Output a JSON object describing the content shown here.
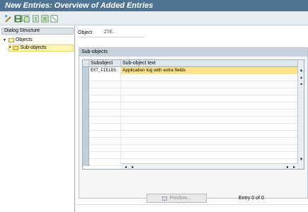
{
  "title": "New Entries: Overview of Added Entries",
  "toolbar": {
    "buttons": [
      {
        "name": "change-display-icon"
      },
      {
        "name": "save-icon"
      },
      {
        "name": "copy-as-icon"
      },
      {
        "name": "delete-icon"
      },
      {
        "name": "select-all-icon"
      },
      {
        "name": "deselect-all-icon"
      }
    ]
  },
  "dialog_structure": {
    "header": "Dialog Structure",
    "items": [
      {
        "label": "Objects",
        "level": 0
      },
      {
        "label": "Sub-objects",
        "level": 1,
        "selected": true
      }
    ]
  },
  "object": {
    "label": "Object",
    "value": "ZTE.."
  },
  "subobjects": {
    "group_title": "Sub-objects",
    "columns": [
      "Subobject",
      "Sub-object text"
    ],
    "rows": [
      [
        "EXT_FIELDS",
        "Application log with extra fields"
      ],
      [
        "",
        ""
      ],
      [
        "",
        ""
      ],
      [
        "",
        ""
      ],
      [
        "",
        ""
      ],
      [
        "",
        ""
      ],
      [
        "",
        ""
      ],
      [
        "",
        ""
      ],
      [
        "",
        ""
      ],
      [
        "",
        ""
      ],
      [
        "",
        ""
      ],
      [
        "",
        ""
      ],
      [
        "",
        ""
      ],
      [
        "",
        ""
      ]
    ]
  },
  "footer": {
    "position_label": "Position...",
    "entry_text": "Entry 0 of 0"
  },
  "colors": {
    "title_bar": "#4f7393",
    "selection": "#ffe28a",
    "tree_selection": "#fdf6b5"
  }
}
